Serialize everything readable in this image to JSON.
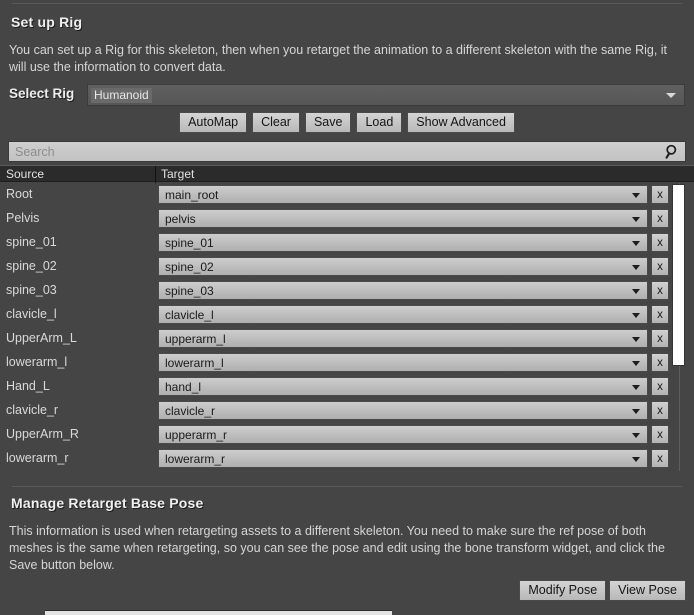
{
  "setup_rig": {
    "title": "Set up Rig",
    "description": "You can set up a Rig for this skeleton, then when you retarget the animation to a different skeleton with the same Rig, it will use the information to convert data.",
    "select_rig_label": "Select Rig",
    "selected_rig": "Humanoid",
    "combo_icon": "chevron-down-icon",
    "buttons": [
      {
        "label": "AutoMap",
        "name": "automap-button"
      },
      {
        "label": "Clear",
        "name": "clear-button"
      },
      {
        "label": "Save",
        "name": "save-button"
      },
      {
        "label": "Load",
        "name": "load-button"
      },
      {
        "label": "Show Advanced",
        "name": "show-advanced-button"
      }
    ]
  },
  "search": {
    "placeholder": "Search",
    "value": "",
    "icon": "search-icon"
  },
  "table": {
    "columns": [
      "Source",
      "Target"
    ],
    "clear_row_label": "x",
    "rows": [
      {
        "source": "Root",
        "target": "main_root"
      },
      {
        "source": "Pelvis",
        "target": "pelvis"
      },
      {
        "source": "spine_01",
        "target": "spine_01"
      },
      {
        "source": "spine_02",
        "target": "spine_02"
      },
      {
        "source": "spine_03",
        "target": "spine_03"
      },
      {
        "source": "clavicle_l",
        "target": "clavicle_l"
      },
      {
        "source": "UpperArm_L",
        "target": "upperarm_l"
      },
      {
        "source": "lowerarm_l",
        "target": "lowerarm_l"
      },
      {
        "source": "Hand_L",
        "target": "hand_l"
      },
      {
        "source": "clavicle_r",
        "target": "clavicle_r"
      },
      {
        "source": "UpperArm_R",
        "target": "upperarm_r"
      },
      {
        "source": "lowerarm_r",
        "target": "lowerarm_r"
      }
    ]
  },
  "manage_retarget": {
    "title": "Manage Retarget Base Pose",
    "description": "This information is used when retargeting assets to a different skeleton. You need to make sure the ref pose of both meshes is the same when retargeting, so you can see the pose and edit using the bone transform widget, and click the Save button below.",
    "buttons": [
      {
        "label": "Modify Pose",
        "name": "modify-pose-button"
      },
      {
        "label": "View Pose",
        "name": "view-pose-button"
      }
    ]
  },
  "colors": {
    "background": "#454545",
    "header_row": "#2b2b2b",
    "field_light": "#cdcdcd",
    "scrollbar_thumb": "#ffffff",
    "text_primary": "#f0f0f0",
    "text_secondary": "#d6d6d6"
  }
}
